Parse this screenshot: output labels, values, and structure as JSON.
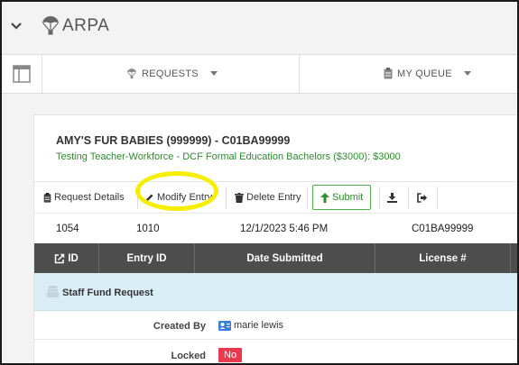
{
  "app": {
    "title": "ARPA"
  },
  "nav": {
    "requests_label": "REQUESTS",
    "queue_label": "MY QUEUE"
  },
  "card": {
    "heading": "AMY'S FUR BABIES (999999) - C01BA99999",
    "subheading": "Testing Teacher-Workforce - DCF Formal Education Bachelors ($3000): $3000"
  },
  "toolbar": {
    "request_details": "Request Details",
    "modify_entry": "Modify Entry",
    "delete_entry": "Delete Entry",
    "submit": "Submit"
  },
  "summary_row": {
    "id": "1054",
    "entry_id": "1010",
    "date_submitted": "12/1/2023 5:46 PM",
    "license": "C01BA99999"
  },
  "table": {
    "headers": [
      "ID",
      "Entry ID",
      "Date Submitted",
      "License #"
    ]
  },
  "group": {
    "label": "Staff Fund Request"
  },
  "details": {
    "created_by_label": "Created By",
    "created_by_value": "marie lewis",
    "locked_label": "Locked",
    "locked_value": "No"
  },
  "colors": {
    "accent_green": "#2e8b2e",
    "header_dark": "#4d4d4d",
    "group_bg": "#d9edf7",
    "badge_red": "#e83a4f",
    "highlight_yellow": "#f6ee00"
  }
}
